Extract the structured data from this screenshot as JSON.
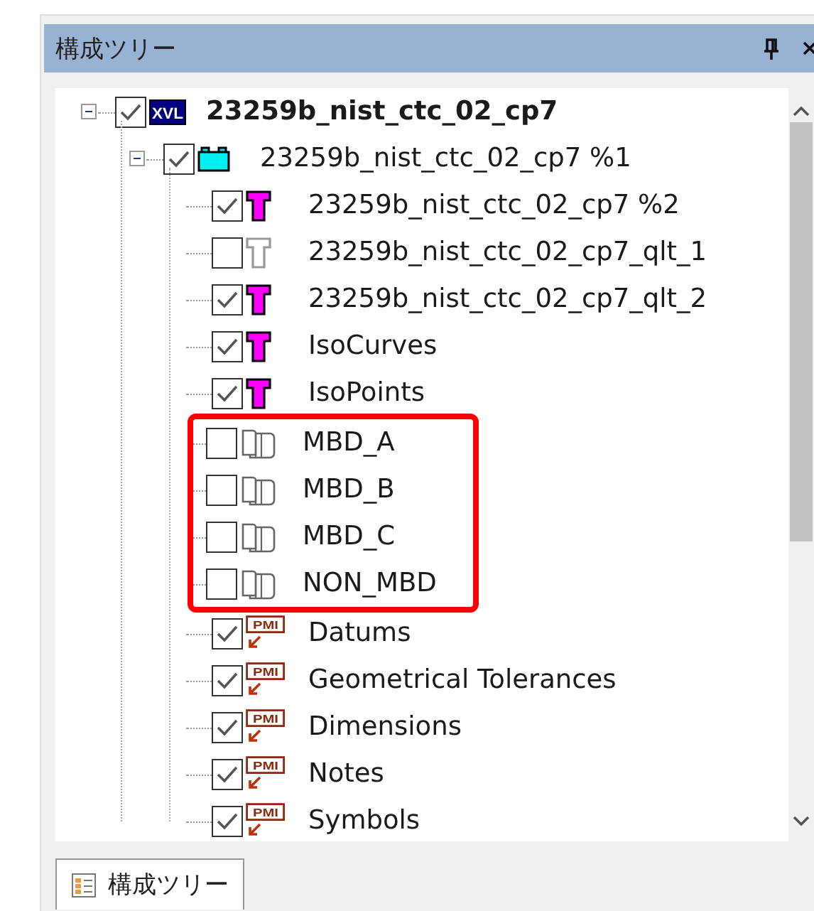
{
  "panel": {
    "title": "構成ツリー"
  },
  "tree": [
    {
      "label": "23259b_nist_ctc_02_cp7",
      "kind": "xvl",
      "icon_label": "XVL",
      "checked": true,
      "expanded": true,
      "highlighted": false,
      "children": [
        {
          "label": "23259b_nist_ctc_02_cp7 %1",
          "kind": "assembly",
          "checked": true,
          "expanded": true,
          "highlighted": false,
          "children": [
            {
              "label": "23259b_nist_ctc_02_cp7 %2",
              "kind": "part",
              "checked": true,
              "highlighted": false
            },
            {
              "label": "23259b_nist_ctc_02_cp7_qlt_1",
              "kind": "part",
              "checked": false,
              "highlighted": false
            },
            {
              "label": "23259b_nist_ctc_02_cp7_qlt_2",
              "kind": "part",
              "checked": true,
              "highlighted": false
            },
            {
              "label": "IsoCurves",
              "kind": "part",
              "checked": true,
              "highlighted": false
            },
            {
              "label": "IsoPoints",
              "kind": "part",
              "checked": true,
              "highlighted": false
            },
            {
              "label": "MBD_A",
              "kind": "layer",
              "checked": false,
              "highlighted": true
            },
            {
              "label": "MBD_B",
              "kind": "layer",
              "checked": false,
              "highlighted": true
            },
            {
              "label": "MBD_C",
              "kind": "layer",
              "checked": false,
              "highlighted": true
            },
            {
              "label": "NON_MBD",
              "kind": "layer",
              "checked": false,
              "highlighted": true
            },
            {
              "label": "Datums",
              "kind": "pmi",
              "icon_label": "PMI",
              "checked": true,
              "highlighted": false
            },
            {
              "label": "Geometrical Tolerances",
              "kind": "pmi",
              "icon_label": "PMI",
              "checked": true,
              "highlighted": false
            },
            {
              "label": "Dimensions",
              "kind": "pmi",
              "icon_label": "PMI",
              "checked": true,
              "highlighted": false
            },
            {
              "label": "Notes",
              "kind": "pmi",
              "icon_label": "PMI",
              "checked": true,
              "highlighted": false
            },
            {
              "label": "Symbols",
              "kind": "pmi",
              "icon_label": "PMI",
              "checked": true,
              "highlighted": false
            }
          ]
        }
      ]
    }
  ],
  "bottom_tabs": [
    {
      "label": "構成ツリー",
      "selected": true
    }
  ]
}
